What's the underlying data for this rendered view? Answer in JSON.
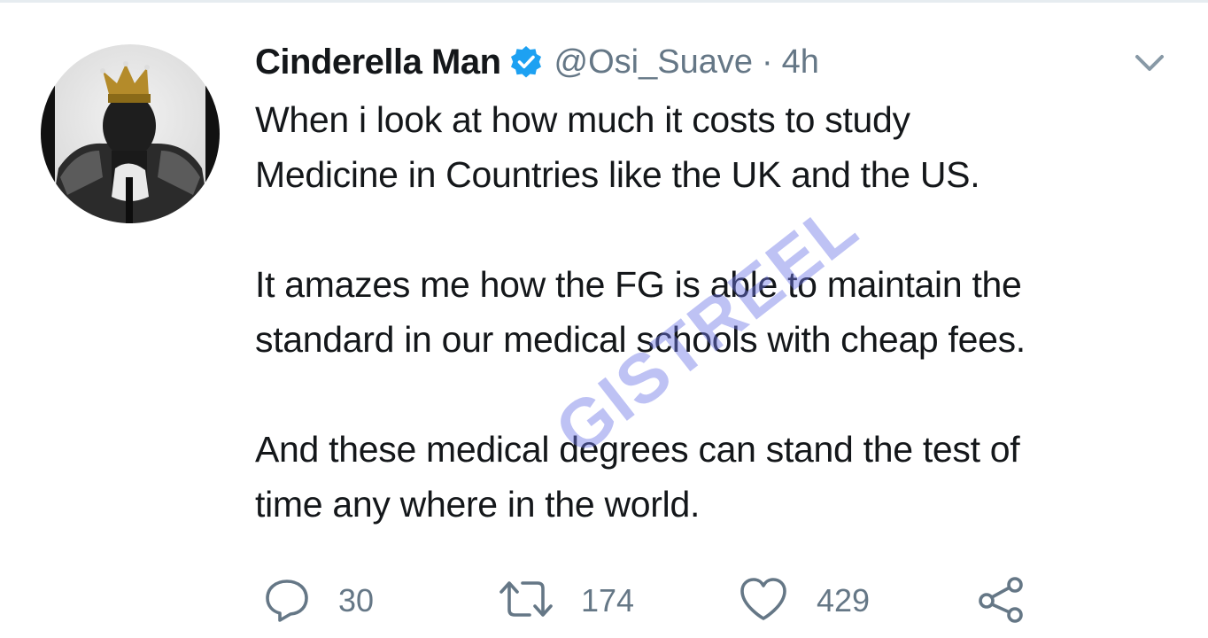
{
  "tweet": {
    "author": {
      "display_name": "Cinderella Man",
      "handle": "@Osi_Suave",
      "verified": true
    },
    "separator": "·",
    "time": "4h",
    "paragraphs": [
      "When i look at how much it costs to study",
      "Medicine in Countries like the UK and the US.",
      "It amazes me how the FG is able to maintain the",
      "standard in our medical schools with cheap fees.",
      "And these medical degrees can stand the test of",
      "time any where in the world."
    ],
    "stats": {
      "replies": "30",
      "retweets": "174",
      "likes": "429"
    }
  },
  "watermark": "GISTREEL",
  "icons": {
    "verified": "verified-badge-icon",
    "caret": "chevron-down-icon",
    "reply": "reply-icon",
    "retweet": "retweet-icon",
    "like": "heart-icon",
    "share": "share-icon"
  },
  "colors": {
    "text": "#14171a",
    "secondary": "#657786",
    "verified": "#1da1f2",
    "watermark": "#6e78e6"
  }
}
